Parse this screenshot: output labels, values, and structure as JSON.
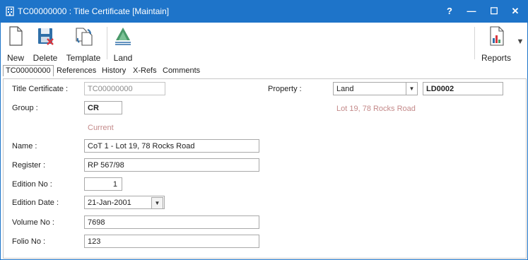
{
  "window": {
    "title": "TC00000000 : Title Certificate [Maintain]",
    "help_glyph": "?",
    "minimize_glyph": "—",
    "maximize_glyph": "☐",
    "close_glyph": "✕",
    "accent_color": "#1e74c9"
  },
  "toolbar": {
    "new_label": "New",
    "delete_label": "Delete",
    "template_label": "Template",
    "land_label": "Land",
    "reports_label": "Reports",
    "more_glyph": "▼"
  },
  "tabs": {
    "items": [
      "TC00000000",
      "References",
      "History",
      "X-Refs",
      "Comments"
    ],
    "active": "TC00000000"
  },
  "form": {
    "title_certificate_label": "Title Certificate :",
    "title_certificate_value": "TC00000000",
    "group_label": "Group :",
    "group_value": "CR",
    "group_status": "Current",
    "name_label": "Name :",
    "name_value": "CoT 1 - Lot 19, 78 Rocks Road",
    "register_label": "Register :",
    "register_value": "RP 567/98",
    "edition_no_label": "Edition No :",
    "edition_no_value": "1",
    "edition_date_label": "Edition Date :",
    "edition_date_value": "21-Jan-2001",
    "volume_no_label": "Volume No :",
    "volume_no_value": "7698",
    "folio_no_label": "Folio No :",
    "folio_no_value": "123",
    "property_label": "Property :",
    "property_type_value": "Land",
    "property_code_value": "LD0002",
    "property_description": "Lot 19, 78 Rocks Road",
    "dropdown_glyph": "▼"
  }
}
